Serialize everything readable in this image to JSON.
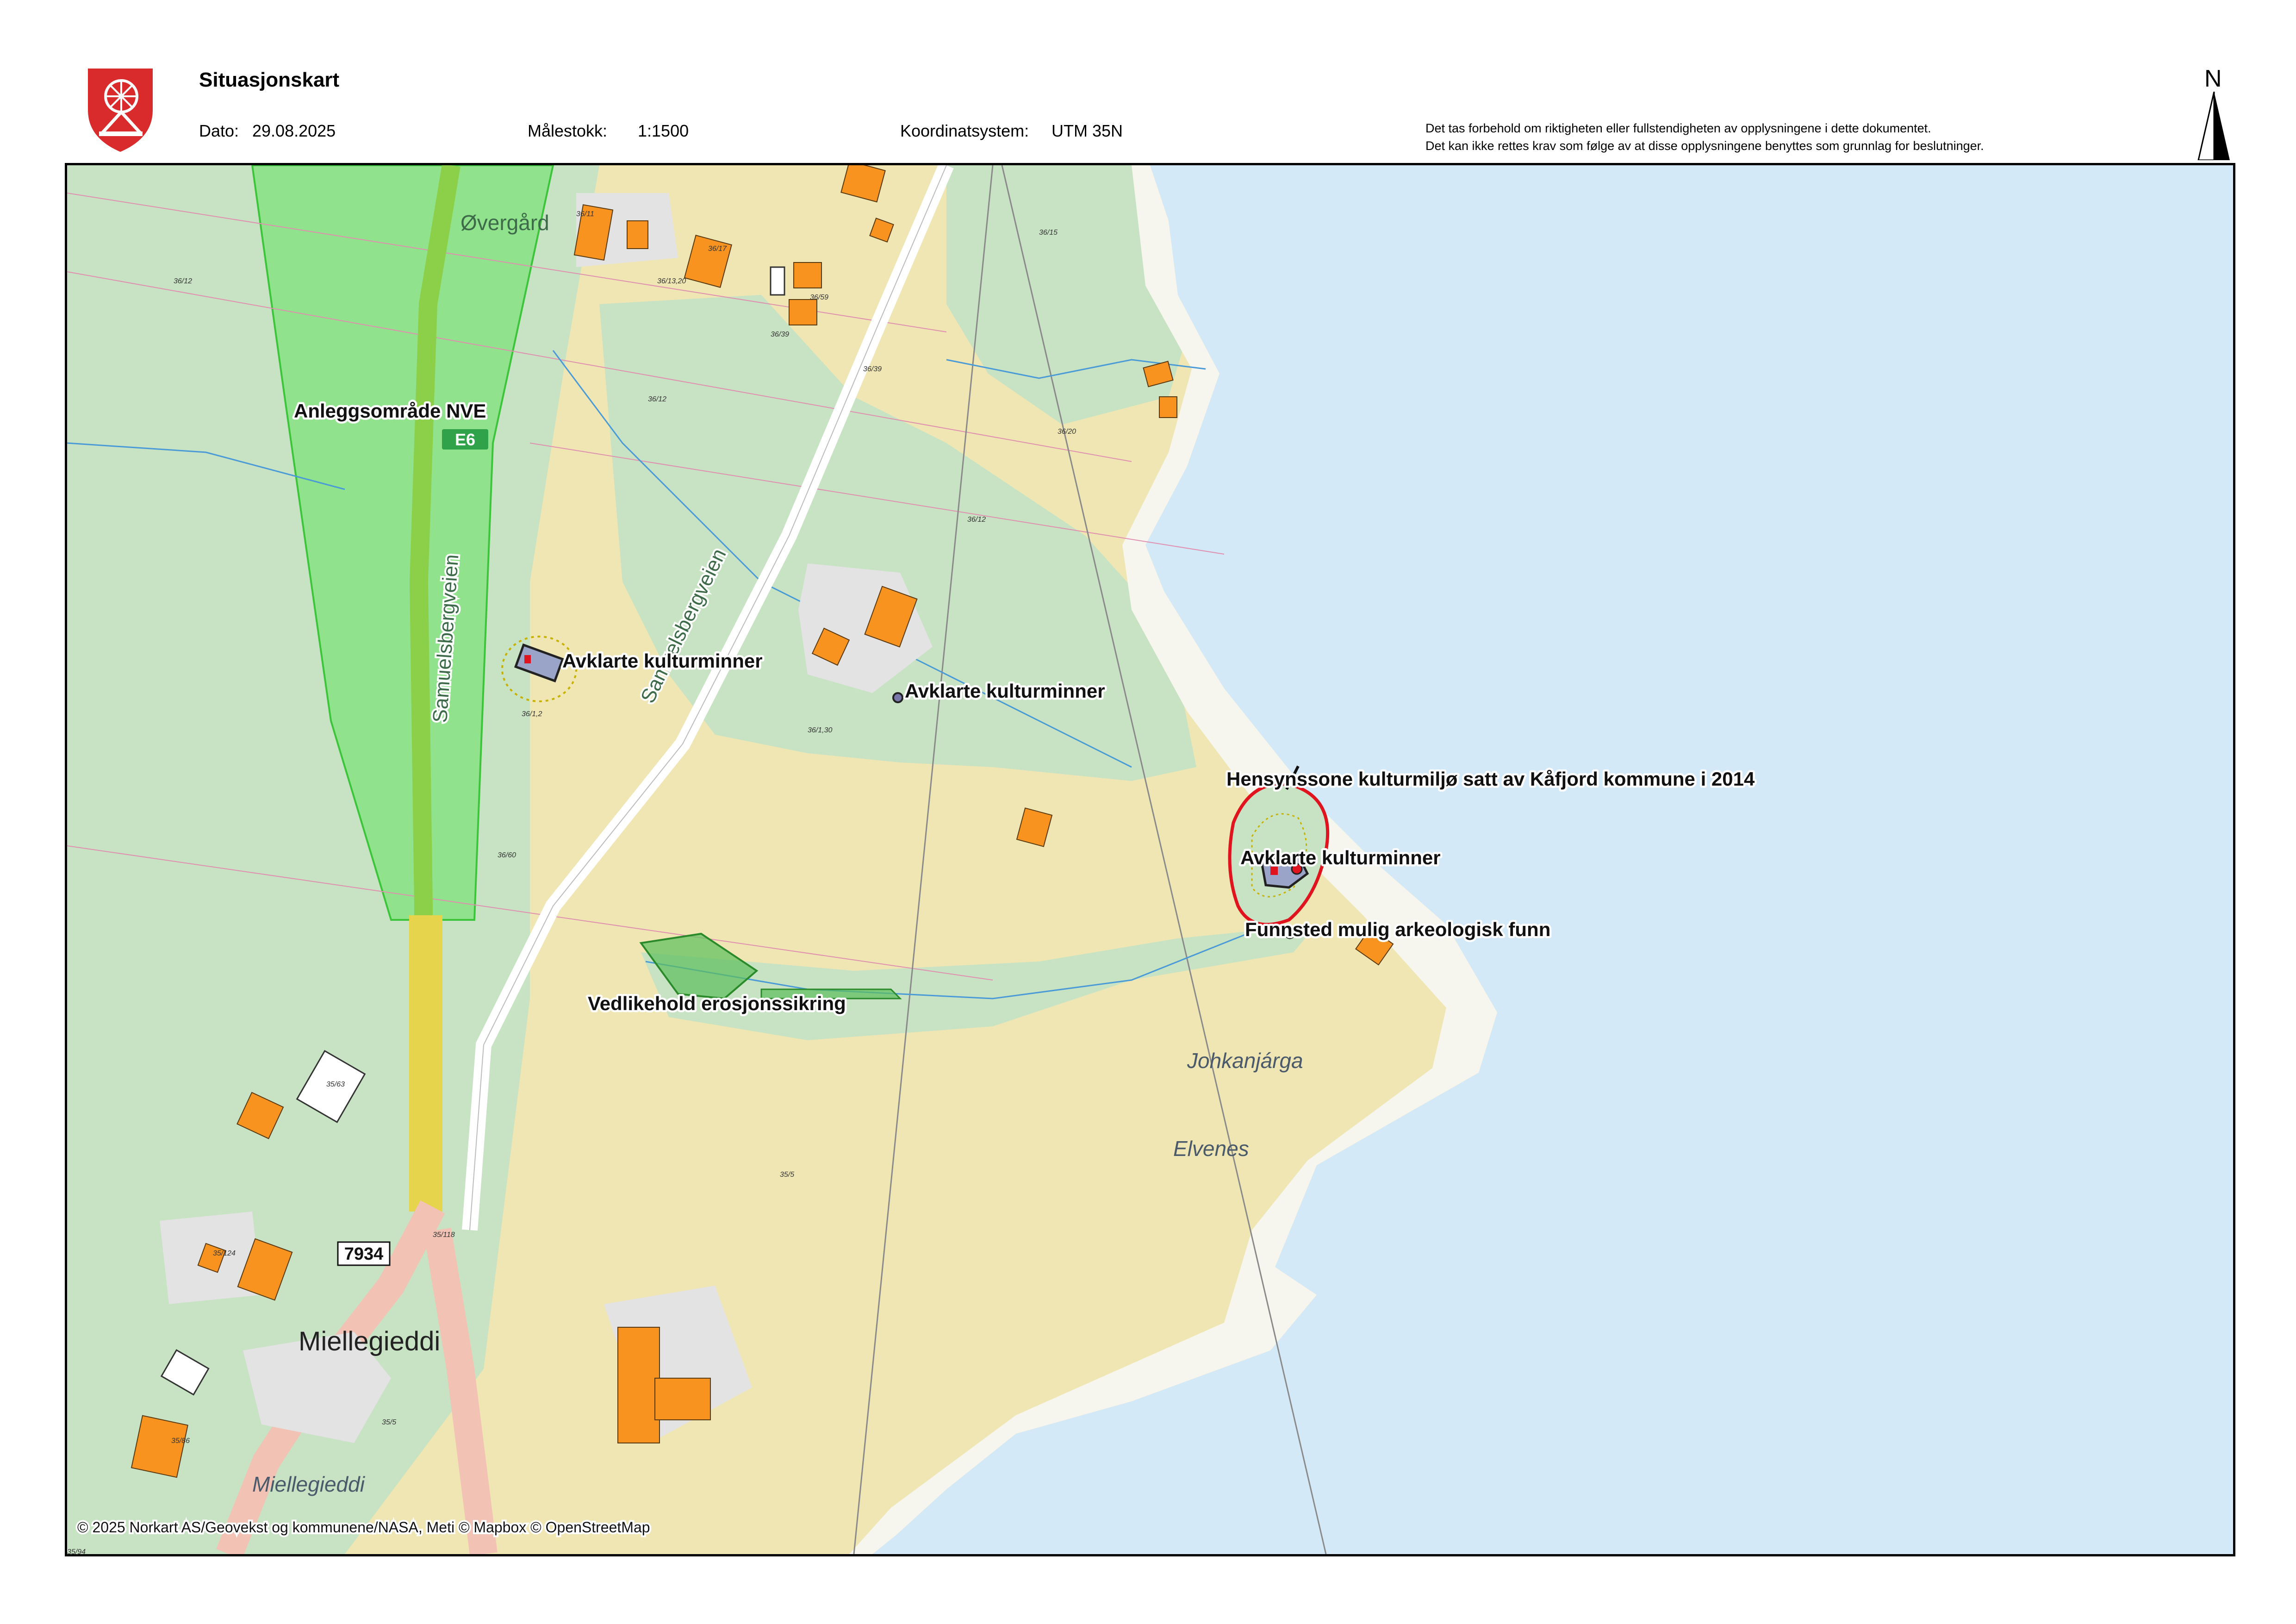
{
  "header": {
    "title": "Situasjonskart",
    "date_label": "Dato:",
    "date_value": "29.08.2025",
    "scale_label": "Målestokk:",
    "scale_value": "1:1500",
    "crs_label": "Koordinatsystem:",
    "crs_value": "UTM 35N",
    "disclaimer_line1": "Det tas forbehold om riktigheten eller fullstendigheten av opplysningene i dette dokumentet.",
    "disclaimer_line2": "Det kan ikke rettes krav som følge av at disse opplysningene benyttes som grunnlag for beslutninger.",
    "north_arrow": "N"
  },
  "logo": {
    "icon": "municipal-coat-of-arms-spinning-wheel",
    "color": "#d92b2b"
  },
  "map": {
    "annotations": {
      "nve_area": "Anleggsområde NVE",
      "culture_1": "Avklarte kulturminner",
      "culture_2": "Avklarte kulturminner",
      "culture_3": "Avklarte kulturminner",
      "heritage_zone": "Hensynssone kulturmiljø satt av Kåfjord kommune i 2014",
      "find_site": "Funnsted mulig arkeologisk funn",
      "erosion": "Vedlikehold erosjonssikring"
    },
    "place_names": {
      "overgard": "Øvergård",
      "johkanjarga": "Johkanjárga",
      "elvenes": "Elvenes",
      "miellegieddi_large": "Miellegieddi",
      "miellegieddi_small": "Miellegieddi"
    },
    "road_names": {
      "samuelsbergveien_1": "Samuelsbergveien",
      "samuelsbergveien_2": "Samuelsbergveien"
    },
    "road_shields": {
      "e6": "E6",
      "county_road": "7934"
    },
    "parcel_labels": [
      "36/12",
      "36/11",
      "36/13,20",
      "36/17",
      "36/59",
      "36/39",
      "36/39",
      "36/15",
      "36/12",
      "36/20",
      "36/12",
      "36/1,2",
      "36/1,30",
      "36/60",
      "35/63",
      "35/5",
      "35/118",
      "35/124",
      "35/5",
      "35/86",
      "35/94"
    ],
    "copyright": "© 2025 Norkart AS/Geovekst og kommunene/NASA, Meti © Mapbox © OpenStreetMap",
    "colors": {
      "sea": "#d4e9f7",
      "forest": "#c8e2c4",
      "farmland": "#efe6b3",
      "building": "#f7931e",
      "nve_area": "#7fe27a",
      "heritage_zone_outline": "#e0141e",
      "main_road": "#e6d44c"
    }
  }
}
